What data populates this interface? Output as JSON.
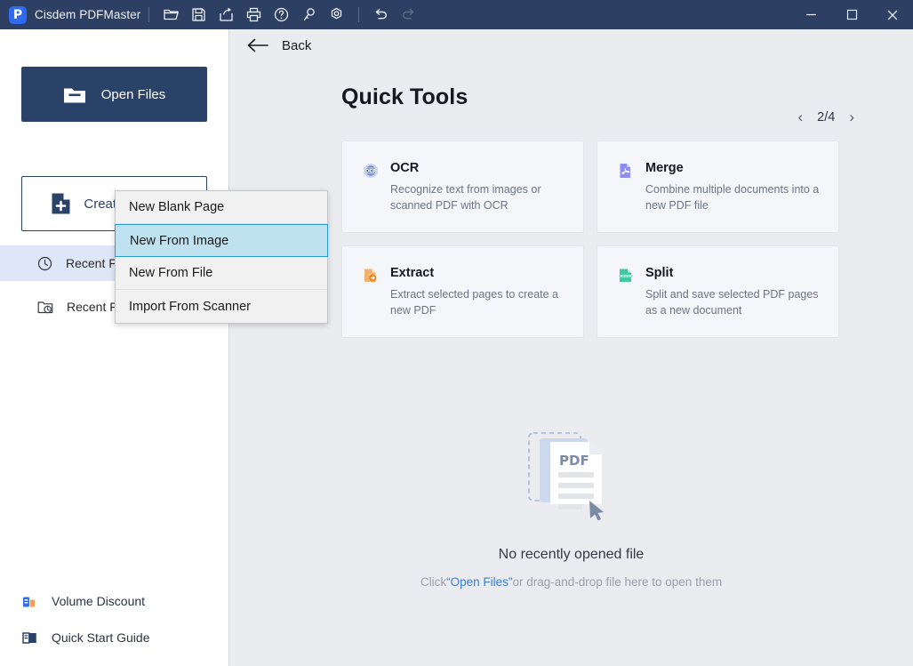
{
  "window": {
    "title": "Cisdem PDFMaster",
    "logo_letter": "P",
    "toolbar_icons": [
      {
        "name": "open-folder-icon",
        "tip": "Open"
      },
      {
        "name": "save-icon",
        "tip": "Save"
      },
      {
        "name": "share-icon",
        "tip": "Share"
      },
      {
        "name": "print-icon",
        "tip": "Print"
      },
      {
        "name": "help-icon",
        "tip": "Help"
      },
      {
        "name": "key-icon",
        "tip": "License"
      },
      {
        "name": "settings-icon",
        "tip": "Settings"
      },
      {
        "name": "undo-icon",
        "tip": "Undo"
      },
      {
        "name": "redo-icon",
        "tip": "Redo"
      }
    ],
    "controls": {
      "minimize": "–",
      "maximize": "□",
      "close": "✕"
    },
    "titlebar_color": "#2d3f63",
    "logo_color": "#2f6bf0"
  },
  "sidebar": {
    "open_files_label": "Open Files",
    "create_pdf_label": "Create PDF",
    "items": [
      {
        "label": "Recent Files",
        "icon": "clock-icon",
        "active": true
      },
      {
        "label": "Recent Folders",
        "icon": "folder-clock-icon",
        "active": false
      }
    ],
    "bottom_items": [
      {
        "label": "Volume Discount",
        "icon": "volume-discount-icon"
      },
      {
        "label": "Quick Start Guide",
        "icon": "book-icon"
      }
    ],
    "accent_color": "#2b4268",
    "active_bg": "#dee7f7"
  },
  "dropdown": {
    "open": true,
    "items": [
      {
        "label": "New Blank Page",
        "selected": false
      },
      {
        "label": "New From Image",
        "selected": true
      },
      {
        "label": "New From File",
        "selected": false
      },
      {
        "label": "Import From Scanner",
        "selected": false
      }
    ],
    "selected_bg": "#bfe2f1",
    "selected_border": "#2d9cd2"
  },
  "main": {
    "back_label": "Back",
    "title": "Quick Tools",
    "pager": {
      "prev": "‹",
      "next": "›",
      "value": "2/4",
      "current": 2,
      "total": 4
    },
    "cards": [
      {
        "title": "OCR",
        "desc": "Recognize text from images or scanned PDF with OCR",
        "icon": "ocr-icon",
        "color": "#8fa6d6"
      },
      {
        "title": "Merge",
        "desc": "Combine multiple documents into a new PDF file",
        "icon": "merge-icon",
        "color": "#7b7fe8"
      },
      {
        "title": "Extract",
        "desc": "Extract selected pages to create a new PDF",
        "icon": "extract-icon",
        "color": "#f0ab5b"
      },
      {
        "title": "Split",
        "desc": "Split and save selected PDF pages as a new document",
        "icon": "split-icon",
        "color": "#3fc9a0"
      }
    ],
    "empty_state": {
      "illustration": "pdf-document-illustration",
      "badge_text": "PDF",
      "title": "No recently opened file",
      "sub_prefix": "Click",
      "sub_link": "“Open Files”",
      "sub_suffix": "or drag-and-drop file here to open them",
      "link_color": "#3a7ddc"
    }
  }
}
